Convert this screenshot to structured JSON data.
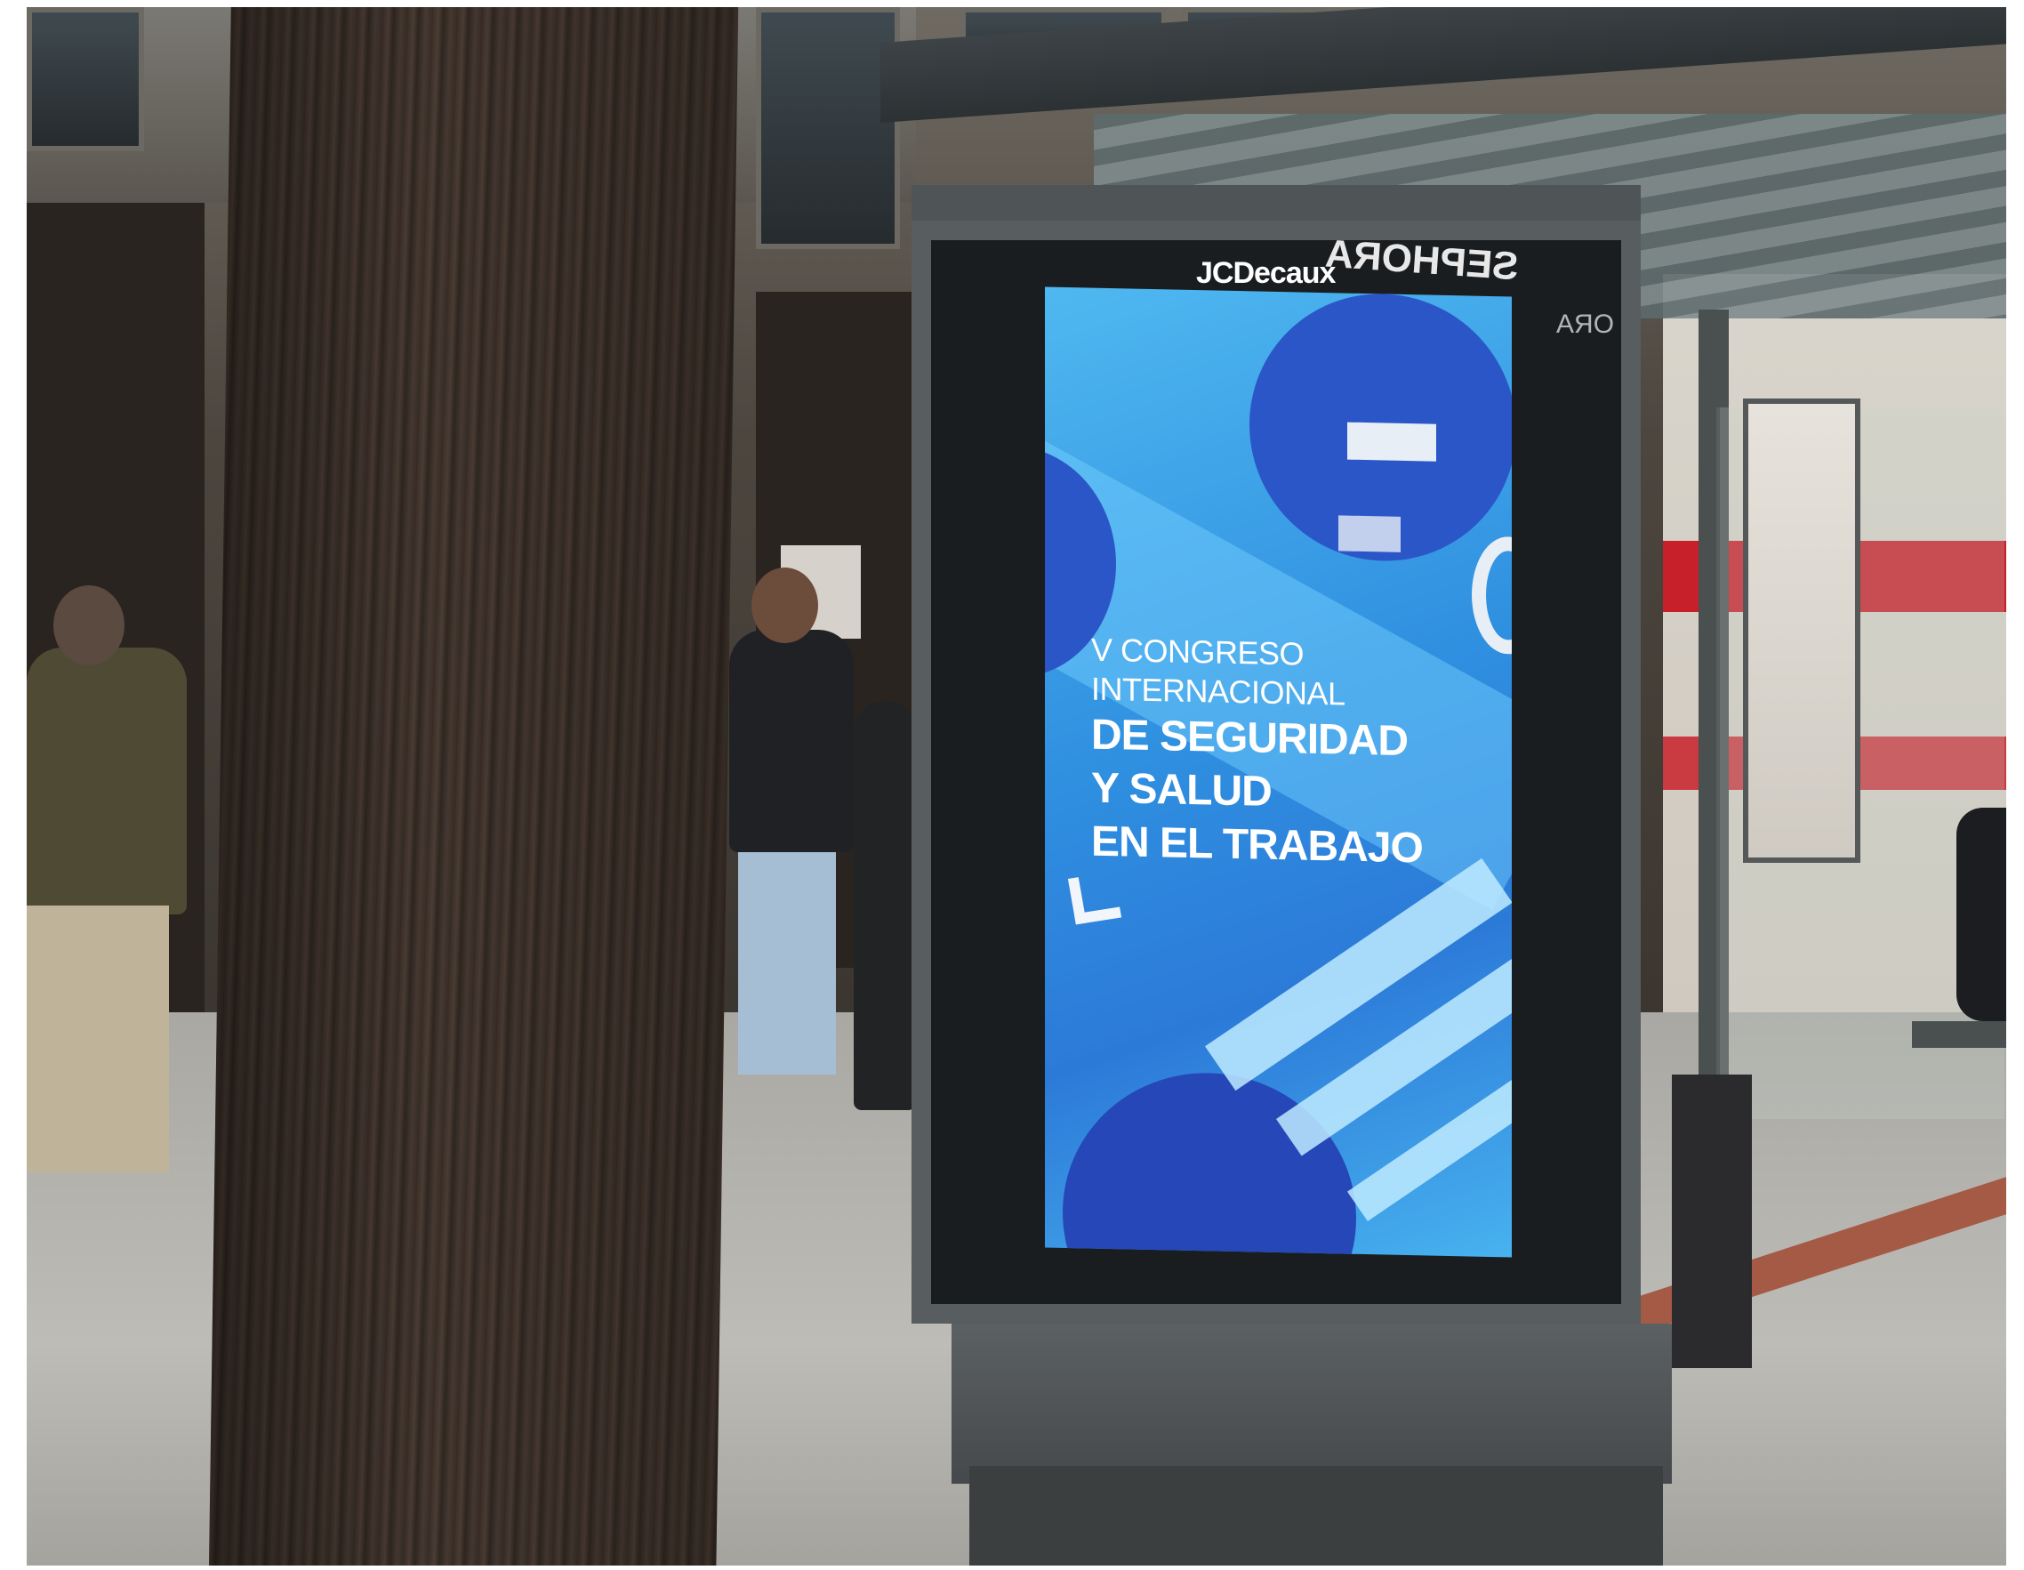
{
  "kiosk": {
    "brand": "JCDecaux",
    "reflection_text": "SEPHORA",
    "reflection_text_small": "ORA"
  },
  "ad": {
    "line1": "V CONGRESO",
    "line2": "INTERNACIONAL",
    "line3": "DE SEGURIDAD",
    "line4": "Y SALUD",
    "line5": "EN EL TRABAJO"
  },
  "colors": {
    "ad_blue": "#2f8fe0",
    "ad_dark_blue": "#2b56c8",
    "shop_red": "#c8202a"
  }
}
